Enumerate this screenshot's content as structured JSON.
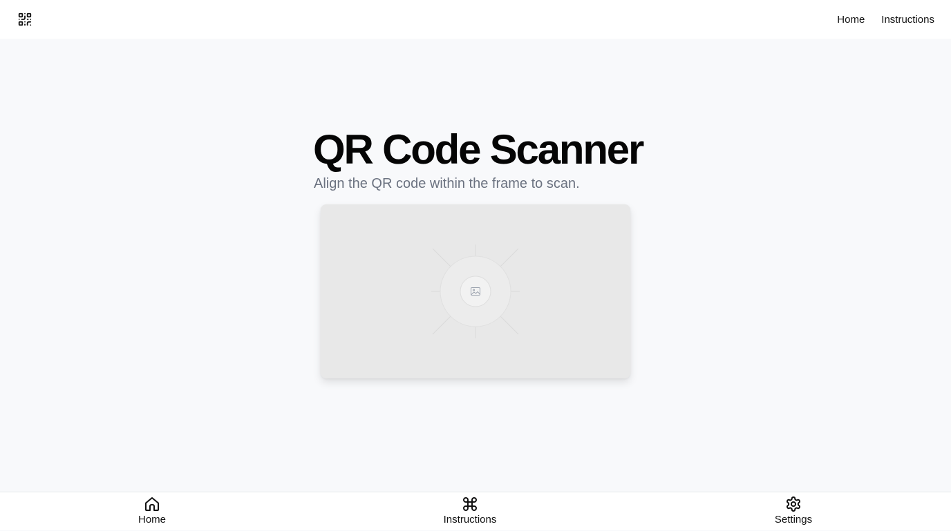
{
  "header": {
    "logo_icon": "qr-code-icon",
    "nav": [
      {
        "label": "Home"
      },
      {
        "label": "Instructions"
      }
    ]
  },
  "main": {
    "title": "QR Code Scanner",
    "subtitle": "Align the QR code within the frame to scan.",
    "scanner": {
      "placeholder_icon": "image-icon"
    }
  },
  "bottom_nav": {
    "items": [
      {
        "label": "Home",
        "icon": "home-icon"
      },
      {
        "label": "Instructions",
        "icon": "command-icon"
      },
      {
        "label": "Settings",
        "icon": "gear-icon"
      }
    ]
  },
  "colors": {
    "background": "#f8f9fb",
    "surface": "#ffffff",
    "subtitle": "#6b7280",
    "frame": "#e8e8e8"
  }
}
